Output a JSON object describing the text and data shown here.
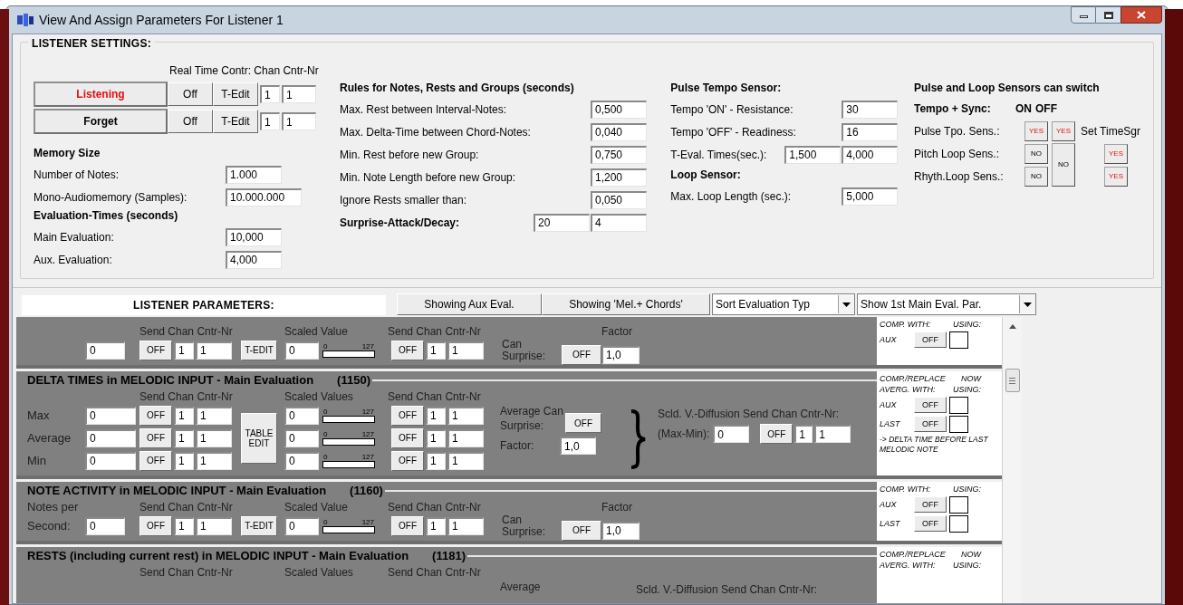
{
  "window": {
    "title": "View And Assign Parameters For Listener 1"
  },
  "settings": {
    "title": "LISTENER SETTINGS:",
    "realtime_label": "Real Time Contr: Chan Cntr-Nr",
    "actions": [
      {
        "label": "Listening",
        "active": true,
        "off": "Off",
        "edit": "T-Edit",
        "chan": "1",
        "cntr": "1"
      },
      {
        "label": "Forget",
        "active": false,
        "off": "Off",
        "edit": "T-Edit",
        "chan": "1",
        "cntr": "1"
      }
    ],
    "memory": {
      "heading": "Memory Size",
      "fields": [
        {
          "label": "Number of Notes:",
          "value": "1.000"
        },
        {
          "label": "Mono-Audiomemory (Samples):",
          "value": "10.000.000"
        }
      ]
    },
    "evaluation": {
      "heading": "Evaluation-Times (seconds)",
      "fields": [
        {
          "label": "Main Evaluation:",
          "value": "10,000"
        },
        {
          "label": "Aux. Evaluation:",
          "value": "4,000"
        }
      ]
    },
    "rules": {
      "heading": "Rules for Notes, Rests and Groups (seconds)",
      "fields": [
        {
          "kind": "plain",
          "label": "Max. Rest between Interval-Notes:",
          "values": [
            "0,500"
          ]
        },
        {
          "kind": "plain",
          "label": "Max. Delta-Time between Chord-Notes:",
          "values": [
            "0,040"
          ]
        },
        {
          "kind": "plain",
          "label": "Min. Rest before new Group:",
          "values": [
            "0,750"
          ]
        },
        {
          "kind": "plain",
          "label": "Min. Note Length before new Group:",
          "values": [
            "1,200"
          ]
        },
        {
          "kind": "plain",
          "label": "Ignore Rests smaller than:",
          "values": [
            "0,050"
          ]
        },
        {
          "kind": "strong",
          "label": "Surprise-Attack/Decay:",
          "values": [
            "20",
            "4"
          ]
        }
      ]
    },
    "pulse": {
      "heading": "Pulse Tempo Sensor:",
      "fields": [
        {
          "label": "Tempo 'ON' - Resistance:",
          "values": [
            "30"
          ]
        },
        {
          "label": "Tempo 'OFF' - Readiness:",
          "values": [
            "16"
          ]
        },
        {
          "label": "T-Eval. Times(sec.):",
          "values": [
            "1,500",
            "4,000"
          ]
        }
      ]
    },
    "loop": {
      "heading": "Loop Sensor:",
      "fields": [
        {
          "label": "Max. Loop Length (sec.):",
          "values": [
            "5,000"
          ]
        }
      ]
    },
    "switch": {
      "heading": "Pulse and Loop Sensors can switch",
      "sync_label": "Tempo + Sync:",
      "sync_on": "ON",
      "sync_off": "OFF",
      "pulse_row": {
        "label": "Pulse Tpo. Sens.:",
        "toggles": [
          {
            "text": "YES",
            "on": true
          },
          {
            "text": "YES",
            "on": true
          }
        ],
        "note": "Set TimeSgr"
      },
      "pitch_row": {
        "label": "Pitch Loop Sens.:",
        "toggle": {
          "text": "NO",
          "on": false
        }
      },
      "rhythm_row": {
        "label": "Rhyth.Loop Sens.:",
        "toggle": {
          "text": "NO",
          "on": false
        }
      },
      "loop_shared": {
        "text": "NO",
        "on": false
      },
      "loop_sync": [
        {
          "text": "YES",
          "on": true
        },
        {
          "text": "YES",
          "on": true
        }
      ]
    }
  },
  "toolbar": {
    "title": "LISTENER PARAMETERS:",
    "buttons": [
      "Showing Aux Eval.",
      "Showing 'Mel.+ Chords'"
    ],
    "dropdowns": [
      "Sort Evaluation Typ",
      "Show 1st Main Eval. Par."
    ]
  },
  "panel": {
    "sections": [
      {
        "kind": "single",
        "send_header": "Send Chan Cntr-Nr",
        "scaled_header": "Scaled Value",
        "send2_header": "Send Chan Cntr-Nr",
        "factor_header": "Factor",
        "surprise_label": "Can Surprise:",
        "surprise_off": "OFF",
        "factor": "1,0",
        "rows": [
          {
            "value": "0",
            "off": "OFF",
            "chan": "1",
            "cntr": "1",
            "edit": "T-EDIT",
            "scaled": "0",
            "min": "0",
            "max": "127",
            "level": 0,
            "off2": "OFF",
            "chan2": "1",
            "cntr2": "1"
          }
        ],
        "compare": {
          "header": [
            [
              "COMP. WITH:",
              "USING:"
            ]
          ],
          "rows": [
            {
              "label": "AUX",
              "button": "OFF",
              "checked": false
            }
          ]
        }
      },
      {
        "kind": "triple",
        "title": "DELTA TIMES in MELODIC INPUT - Main Evaluation",
        "code": "(1150)",
        "send_header": "Send Chan Cntr-Nr",
        "scaled_header": "Scaled Values",
        "send2_header": "Send Chan Cntr-Nr",
        "surprise_label": "Average Can Surprise:",
        "surprise_off": "OFF",
        "factor_label": "Factor:",
        "factor": "1,0",
        "edit": "TABLE EDIT",
        "diffusion_label": "Scld. V.-Diffusion Send Chan Cntr-Nr:",
        "diffusion": {
          "label": "(Max-Min):",
          "value": "0",
          "off": "OFF",
          "chan": "1",
          "cntr": "1"
        },
        "rows": [
          {
            "label": "Max",
            "value": "0",
            "off": "OFF",
            "chan": "1",
            "cntr": "1",
            "scaled": "0",
            "min": "0",
            "max": "127",
            "level": 0,
            "off2": "OFF",
            "chan2": "1",
            "cntr2": "1"
          },
          {
            "label": "Average",
            "value": "0",
            "off": "OFF",
            "chan": "1",
            "cntr": "1",
            "scaled": "0",
            "min": "0",
            "max": "127",
            "level": 0,
            "off2": "OFF",
            "chan2": "1",
            "cntr2": "1"
          },
          {
            "label": "Min",
            "value": "0",
            "off": "OFF",
            "chan": "1",
            "cntr": "1",
            "scaled": "0",
            "min": "0",
            "max": "127",
            "level": 0,
            "off2": "OFF",
            "chan2": "1",
            "cntr2": "1"
          }
        ],
        "compare": {
          "header": [
            [
              "COMP./REPLACE",
              "NOW"
            ],
            [
              "AVERG. WITH:",
              "USING:"
            ]
          ],
          "rows": [
            {
              "label": "AUX",
              "button": "OFF",
              "checked": false
            },
            {
              "label": "LAST",
              "button": "OFF",
              "checked": false
            }
          ],
          "note": "-> DELTA TIME BEFORE LAST MELODIC NOTE"
        }
      },
      {
        "kind": "single",
        "title": "NOTE ACTIVITY in MELODIC INPUT - Main Evaluation",
        "code": "(1160)",
        "send_header": "Send Chan Cntr-Nr",
        "scaled_header": "Scaled Value",
        "send2_header": "Send Chan Cntr-Nr",
        "factor_header": "Factor",
        "label_top": "Notes per",
        "surprise_label": "Can Surprise:",
        "surprise_off": "OFF",
        "factor": "1,0",
        "rows": [
          {
            "label": "Second:",
            "value": "0",
            "off": "OFF",
            "chan": "1",
            "cntr": "1",
            "edit": "T-EDIT",
            "scaled": "0",
            "min": "0",
            "max": "127",
            "level": 0,
            "off2": "OFF",
            "chan2": "1",
            "cntr2": "1"
          }
        ],
        "compare": {
          "header": [
            [
              "COMP. WITH:",
              "USING:"
            ]
          ],
          "rows": [
            {
              "label": "AUX",
              "button": "OFF",
              "checked": false
            },
            {
              "label": "LAST",
              "button": "OFF",
              "checked": false
            }
          ]
        }
      },
      {
        "kind": "triple",
        "title": "RESTS (including current rest) in MELODIC INPUT - Main Evaluation",
        "code": "(1181)",
        "send_header": "Send Chan Cntr-Nr",
        "scaled_header": "Scaled Values",
        "send2_header": "Send Chan Cntr-Nr",
        "surprise_label": "Average",
        "diffusion_label": "Scld. V.-Diffusion Send Chan Cntr-Nr:",
        "compare": {
          "header": [
            [
              "COMP./REPLACE",
              "NOW"
            ],
            [
              "AVERG. WITH:",
              "USING:"
            ]
          ]
        }
      }
    ]
  }
}
